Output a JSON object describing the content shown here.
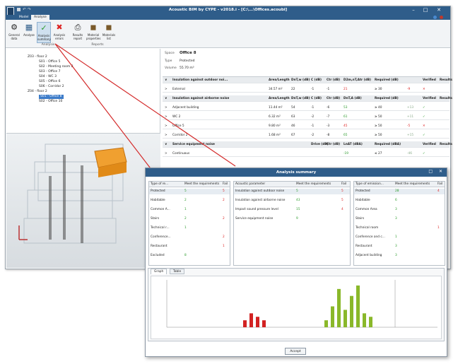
{
  "app": {
    "title": "Acoustic BIM by CYPE - v2018.i - [C:\\...\\Offices.acoubi]"
  },
  "tabs": [
    "Model",
    "Analyse"
  ],
  "ribbon": {
    "buttons": [
      {
        "label": "General\ndata",
        "icon": "gear-icon"
      },
      {
        "label": "Analyse",
        "icon": "calculator-icon"
      },
      {
        "label": "Analysis\nsummary",
        "icon": "checkmark-icon"
      },
      {
        "label": "Analysis\nerrors",
        "icon": "error-x-icon"
      },
      {
        "label": "Results\nreport",
        "icon": "printer-icon"
      },
      {
        "label": "Material\nproperties",
        "icon": "material-icon"
      },
      {
        "label": "Materials\nlist",
        "icon": "materials-list-icon"
      }
    ],
    "groups": [
      "Analysis",
      "Reports"
    ]
  },
  "tree": {
    "items": [
      {
        "label": "Z03 - floor 2",
        "level": 0
      },
      {
        "label": "S01 - Office 5",
        "level": 1
      },
      {
        "label": "S02 - Meeting room 2",
        "level": 1
      },
      {
        "label": "S03 - Office 7",
        "level": 1
      },
      {
        "label": "S04 - WC 3",
        "level": 1
      },
      {
        "label": "S05 - Office 6",
        "level": 1
      },
      {
        "label": "S06 - Corridor 2",
        "level": 1
      },
      {
        "label": "Z04 - floor 2",
        "level": 0
      },
      {
        "label": "S01 - Office 8",
        "level": 1,
        "selected": true
      },
      {
        "label": "S02 - Office 10",
        "level": 1
      }
    ]
  },
  "props": {
    "space_label": "Space",
    "space_value": "Office 8",
    "type_label": "Type",
    "type_value": "Protected",
    "volume_label": "Volume",
    "volume_value": "55.70 m³"
  },
  "grid": {
    "rows": [
      {
        "kind": "header",
        "cells": [
          "Insulation against outdoor noi...",
          "Area/Length",
          "DnT,w (dB)",
          "C (dB)",
          "Ctr (dB)",
          "D2m,nT,Atr (dB)",
          "Required (dB)",
          "",
          "Verified",
          "Results"
        ]
      },
      {
        "kind": "row",
        "cells": [
          "External",
          "34.57 m²",
          "22",
          "-1",
          "-1",
          "21",
          "≥ 30",
          "-9",
          "✕",
          ""
        ],
        "status": "red"
      },
      {
        "kind": "header",
        "cells": [
          "Insulation against airborne noise",
          "Area/Length",
          "DnT,w (dB)",
          "C (dB)",
          "Ctr (dB)",
          "DnT,A (dB)",
          "Required (dB)",
          "",
          "Verified",
          "Results"
        ]
      },
      {
        "kind": "row",
        "cells": [
          "Adjacent building",
          "11.44 m²",
          "54",
          "-1",
          "-6",
          "53",
          "≥ 40",
          "+13",
          "✓",
          ""
        ],
        "status": "grn"
      },
      {
        "kind": "row",
        "cells": [
          "WC 2",
          "6.32 m²",
          "63",
          "-2",
          "-7",
          "61",
          "≥ 50",
          "+11",
          "✓",
          ""
        ],
        "status": "grn"
      },
      {
        "kind": "row",
        "cells": [
          "Office 5",
          "9.80 m²",
          "46",
          "-1",
          "-3",
          "45",
          "≥ 50",
          "-5",
          "✕",
          ""
        ],
        "status": "red"
      },
      {
        "kind": "row",
        "cells": [
          "Corridor 2",
          "1.68 m²",
          "67",
          "-2",
          "-8",
          "65",
          "≥ 50",
          "+15",
          "✓",
          ""
        ],
        "status": "grn"
      },
      {
        "kind": "header",
        "cells": [
          "Service equipment noise",
          "",
          "",
          "Drive (dB)",
          "Ctr (dB)",
          "LnAT (dBA)",
          "Required (dBA)",
          "",
          "Verified",
          "Results"
        ]
      },
      {
        "kind": "row",
        "cells": [
          "Continuous",
          "",
          "",
          "",
          "",
          "-19",
          "≤ 27",
          "-46",
          "✓",
          ""
        ],
        "status": "grn"
      }
    ]
  },
  "dialog": {
    "title": "Analysis summary",
    "t1": {
      "headers": [
        "Type of re...",
        "Meet the requirements",
        "Fail"
      ],
      "rows": [
        [
          "Protected",
          "5",
          "5"
        ],
        [
          "Habitable",
          "2",
          "2"
        ],
        [
          "Common A...",
          "1",
          ""
        ],
        [
          "Stairs",
          "2",
          "2"
        ],
        [
          "Technical r...",
          "1",
          ""
        ],
        [
          "Conference...",
          "",
          "2"
        ],
        [
          "Restaurant",
          "",
          "1"
        ],
        [
          "Excluded",
          "8",
          ""
        ]
      ]
    },
    "t2": {
      "headers": [
        "Acoustic parameter",
        "Meet the requirements",
        "Fail"
      ],
      "rows": [
        [
          "Insulation against outdoor noise",
          "5",
          "5"
        ],
        [
          "Insulation against airborne noise",
          "43",
          "5"
        ],
        [
          "Impact sound pressure level",
          "15",
          "4"
        ],
        [
          "Service equipment noise",
          "9",
          ""
        ]
      ]
    },
    "t3": {
      "headers": [
        "Type of emission...",
        "Meet the requirements",
        "Fail"
      ],
      "rows": [
        [
          "Protected",
          "28",
          "4"
        ],
        [
          "Habitable",
          "6",
          ""
        ],
        [
          "Common Area",
          "3",
          ""
        ],
        [
          "Stairs",
          "3",
          ""
        ],
        [
          "Technical room",
          "",
          "1"
        ],
        [
          "Conference and c...",
          "1",
          ""
        ],
        [
          "Restaurant",
          "3",
          ""
        ],
        [
          "Adjacent building",
          "3",
          ""
        ]
      ]
    },
    "graph_tabs": [
      "Graph",
      "Table"
    ],
    "accept": "Accept"
  },
  "colors": {
    "accent": "#2f5d8a",
    "red": "#d22222",
    "green": "#8ab82a"
  },
  "chart_data": {
    "type": "bar",
    "series": [
      {
        "name": "",
        "color": "#d22222",
        "values": [
          2,
          4,
          3,
          2
        ]
      },
      {
        "name": "",
        "color": "#8ab82a",
        "values": [
          2,
          6,
          11,
          5,
          9,
          12,
          4,
          3
        ]
      }
    ],
    "xlabel": "",
    "ylabel": ""
  }
}
